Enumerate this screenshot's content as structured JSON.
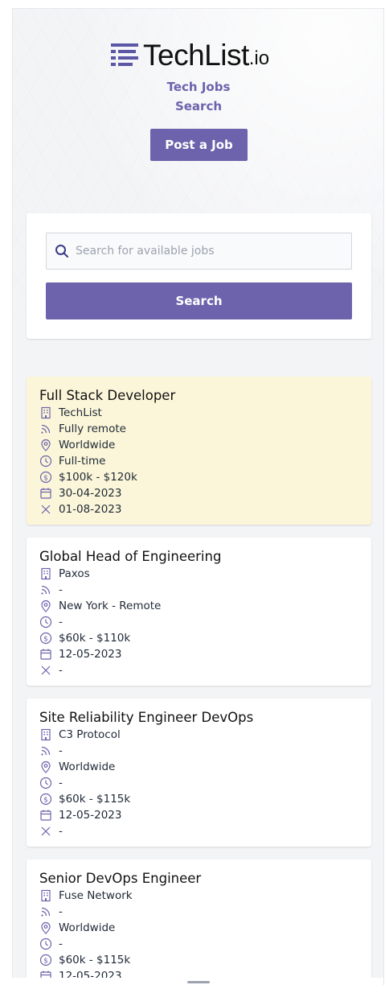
{
  "brand": {
    "name": "TechList",
    "suffix": ".io"
  },
  "nav": {
    "tech_jobs": "Tech Jobs",
    "search": "Search"
  },
  "post_job_label": "Post a Job",
  "search": {
    "placeholder": "Search for available jobs",
    "button_label": "Search"
  },
  "colors": {
    "accent": "#6c63ac",
    "featured_bg": "#fbf6d9"
  },
  "jobs": [
    {
      "title": "Full Stack Developer",
      "company": "TechList",
      "remote": "Fully remote",
      "location": "Worldwide",
      "type": "Full-time",
      "salary": "$100k - $120k",
      "posted": "30-04-2023",
      "expires": "01-08-2023",
      "featured": true
    },
    {
      "title": "Global Head of Engineering",
      "company": "Paxos",
      "remote": "-",
      "location": "New York - Remote",
      "type": "-",
      "salary": "$60k - $110k",
      "posted": "12-05-2023",
      "expires": "-",
      "featured": false
    },
    {
      "title": "Site Reliability Engineer DevOps",
      "company": "C3 Protocol",
      "remote": "-",
      "location": "Worldwide",
      "type": "-",
      "salary": "$60k - $115k",
      "posted": "12-05-2023",
      "expires": "-",
      "featured": false
    },
    {
      "title": "Senior DevOps Engineer",
      "company": "Fuse Network",
      "remote": "-",
      "location": "Worldwide",
      "type": "-",
      "salary": "$60k - $115k",
      "posted": "12-05-2023",
      "expires": "",
      "featured": false
    }
  ],
  "icons": [
    "building-icon",
    "rss-icon",
    "location-pin-icon",
    "clock-icon",
    "dollar-icon",
    "calendar-icon",
    "close-icon"
  ]
}
